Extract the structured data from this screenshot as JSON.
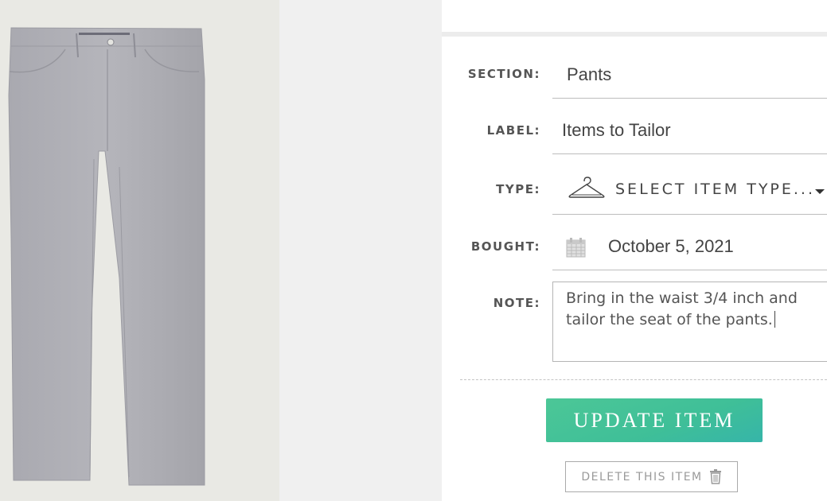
{
  "product_image": {
    "subject": "gray five-pocket pants",
    "icon": "pants-photo"
  },
  "form": {
    "section": {
      "label": "SECTION:",
      "value": "Pants"
    },
    "label": {
      "label": "LABEL:",
      "value": "Items to Tailor"
    },
    "type": {
      "label": "TYPE:",
      "placeholder": "SELECT ITEM TYPE...",
      "icon": "hanger-icon"
    },
    "bought": {
      "label": "BOUGHT:",
      "value": "October 5, 2021",
      "icon": "calendar-icon"
    },
    "note": {
      "label": "NOTE:",
      "value": "Bring in the waist 3/4 inch and tailor the seat of the pants."
    }
  },
  "actions": {
    "update_label": "UPDATE ITEM",
    "delete_label": "DELETE THIS ITEM",
    "delete_icon": "trash-icon"
  },
  "colors": {
    "accent": "#43c29a",
    "text": "#444444",
    "label": "#555555"
  }
}
